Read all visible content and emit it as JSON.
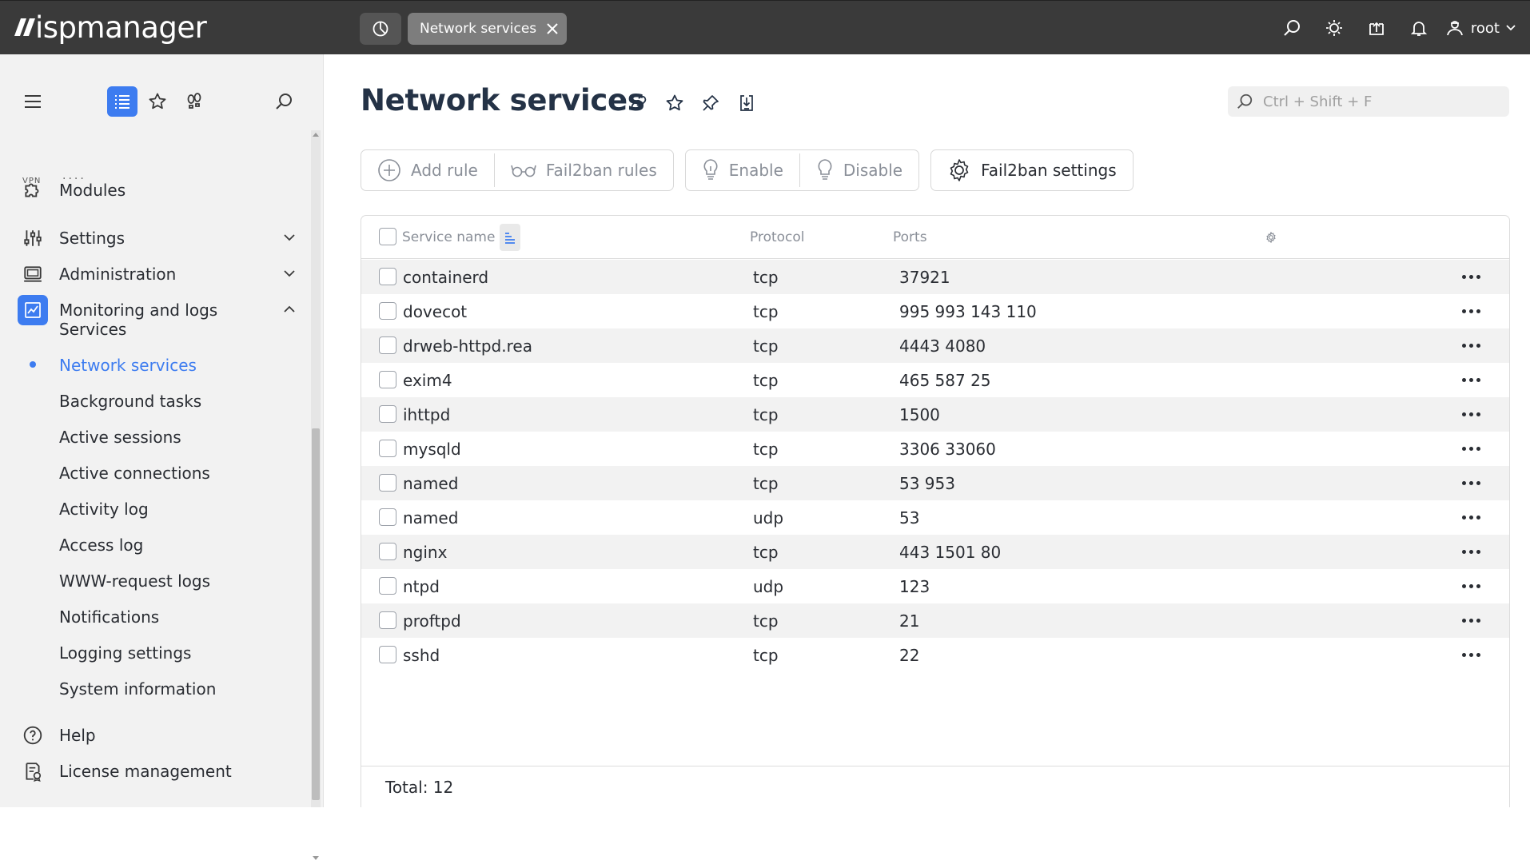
{
  "app": {
    "brand": "ispmanager"
  },
  "topbar": {
    "open_tab_label": "Network services",
    "icons": [
      "search-icon",
      "theme-sun-icon",
      "upload-icon",
      "bell-icon",
      "user-icon"
    ],
    "user_label": "root"
  },
  "sidebar": {
    "tools": [
      "hamburger-icon",
      "list-icon",
      "star-icon",
      "footprints-icon",
      "search-icon"
    ],
    "vpn_stub": "VPN",
    "items": [
      {
        "label": "Modules",
        "icon": "puzzle-icon"
      },
      {
        "label": "Settings",
        "icon": "sliders-icon",
        "expanded": false
      },
      {
        "label": "Administration",
        "icon": "monitor-icon",
        "expanded": false
      },
      {
        "label": "Monitoring and logs",
        "icon": "chart-icon",
        "expanded": true
      }
    ],
    "sub_items": [
      "Services",
      "Network services",
      "Background tasks",
      "Active sessions",
      "Active connections",
      "Activity log",
      "Access log",
      "WWW-request logs",
      "Notifications",
      "Logging settings",
      "System information"
    ],
    "current_sub_item": "Network services",
    "bottom_items": [
      {
        "label": "Help",
        "icon": "help-icon"
      },
      {
        "label": "License management",
        "icon": "license-icon"
      }
    ]
  },
  "main": {
    "title": "Network services",
    "search_placeholder": "Ctrl + Shift + F",
    "toolbar": {
      "add_rule": "Add rule",
      "fail2ban_rules": "Fail2ban rules",
      "enable": "Enable",
      "disable": "Disable",
      "fail2ban_settings": "Fail2ban settings"
    },
    "table": {
      "columns": [
        "Service name",
        "Protocol",
        "Ports"
      ],
      "rows": [
        {
          "name": "containerd",
          "protocol": "tcp",
          "ports": "37921"
        },
        {
          "name": "dovecot",
          "protocol": "tcp",
          "ports": "995 993 143 110"
        },
        {
          "name": "drweb-httpd.rea",
          "protocol": "tcp",
          "ports": "4443 4080"
        },
        {
          "name": "exim4",
          "protocol": "tcp",
          "ports": "465 587 25"
        },
        {
          "name": "ihttpd",
          "protocol": "tcp",
          "ports": "1500"
        },
        {
          "name": "mysqld",
          "protocol": "tcp",
          "ports": "3306 33060"
        },
        {
          "name": "named",
          "protocol": "tcp",
          "ports": "53 953"
        },
        {
          "name": "named",
          "protocol": "udp",
          "ports": "53"
        },
        {
          "name": "nginx",
          "protocol": "tcp",
          "ports": "443 1501 80"
        },
        {
          "name": "ntpd",
          "protocol": "udp",
          "ports": "123"
        },
        {
          "name": "proftpd",
          "protocol": "tcp",
          "ports": "21"
        },
        {
          "name": "sshd",
          "protocol": "tcp",
          "ports": "22"
        }
      ],
      "total_label": "Total: 12"
    }
  },
  "colors": {
    "topbar": "#3a3a3a",
    "accent": "#3d7cf0",
    "sidebar": "#f2f2f2",
    "row_alt": "#f2f2f2"
  }
}
